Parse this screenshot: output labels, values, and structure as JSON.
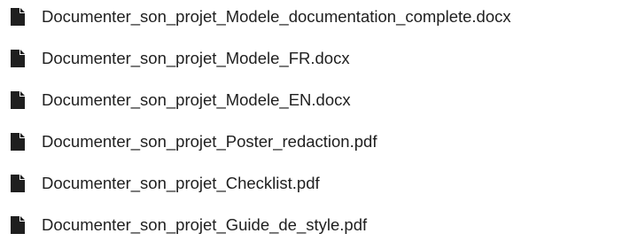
{
  "files": [
    {
      "name": "Documenter_son_projet_Modele_documentation_complete.docx",
      "icon": "file-icon"
    },
    {
      "name": "Documenter_son_projet_Modele_FR.docx",
      "icon": "file-icon"
    },
    {
      "name": "Documenter_son_projet_Modele_EN.docx",
      "icon": "file-icon"
    },
    {
      "name": "Documenter_son_projet_Poster_redaction.pdf",
      "icon": "file-icon"
    },
    {
      "name": "Documenter_son_projet_Checklist.pdf",
      "icon": "file-icon"
    },
    {
      "name": "Documenter_son_projet_Guide_de_style.pdf",
      "icon": "file-icon"
    }
  ],
  "colors": {
    "text": "#1f1f1f",
    "icon": "#1f1f1f",
    "background": "#ffffff"
  }
}
